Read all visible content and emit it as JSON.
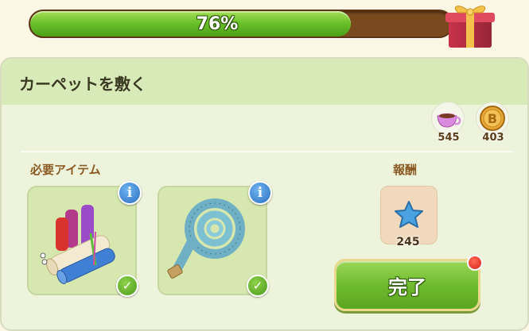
{
  "progress": {
    "percent": 76,
    "label": "76%"
  },
  "task": {
    "title": "カーペットを敷く"
  },
  "currencies": [
    {
      "icon": "teacup-icon",
      "amount": "545"
    },
    {
      "icon": "coin-icon",
      "amount": "403"
    }
  ],
  "required": {
    "label": "必要アイテム",
    "items": [
      {
        "icon": "fabric-rolls-icon",
        "completed": true
      },
      {
        "icon": "measuring-tape-icon",
        "completed": true
      }
    ]
  },
  "reward": {
    "label": "報酬",
    "icon": "star-icon",
    "value": "245"
  },
  "complete_button": {
    "label": "完了",
    "has_notification": true
  },
  "colors": {
    "accent_green": "#6fbb2e",
    "progress_track": "#7a4a1f",
    "panel": "#eef3dc"
  }
}
